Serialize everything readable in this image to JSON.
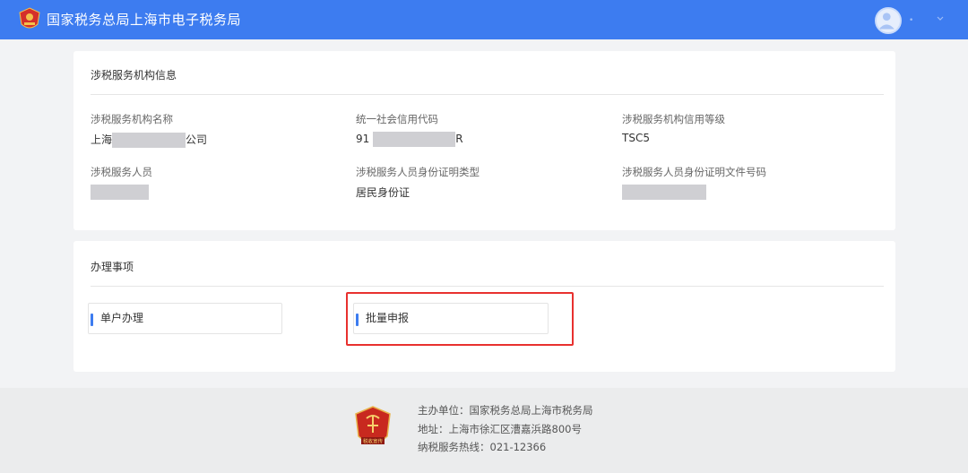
{
  "header": {
    "site_title": "国家税务总局上海市电子税务局",
    "logo_icon": "tax-emblem-icon",
    "user_icon": "user-avatar-icon",
    "user_name_dots": "•",
    "caret_icon": "chevron-down-icon",
    "background_color": "#3d7cf0"
  },
  "agency_info": {
    "title": "涉税服务机构信息",
    "fields": [
      {
        "label": "涉税服务机构名称",
        "value_prefix": "上海",
        "value_suffix": "公司"
      },
      {
        "label": "统一社会信用代码",
        "value_prefix": "91",
        "value_suffix": "R"
      },
      {
        "label": "涉税服务机构信用等级",
        "value": "TSC5"
      },
      {
        "label": "涉税服务人员"
      },
      {
        "label": "涉税服务人员身份证明类型",
        "value": "居民身份证"
      },
      {
        "label": "涉税服务人员身份证明文件号码"
      }
    ]
  },
  "tasks": {
    "title": "办理事项",
    "items": [
      {
        "label": "单户办理"
      },
      {
        "label": "批量申报"
      }
    ],
    "accent_color": "#3d7cf0",
    "highlight_color": "#e8312f"
  },
  "footer": {
    "sponsor": "主办单位：国家税务总局上海市税务局",
    "address": "地址：上海市徐汇区漕嘉浜路800号",
    "hotline": "纳税服务热线：021-12366",
    "emblem_icon": "tax-badge-icon",
    "emblem_text": "税收宣传"
  }
}
